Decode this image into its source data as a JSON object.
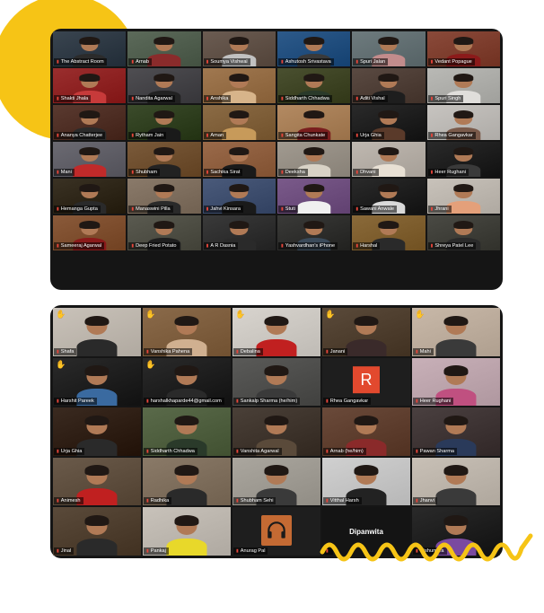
{
  "panel1": {
    "tiles": [
      {
        "name": "The Abstract Room",
        "bg": "#3a4550",
        "shirt": "#2b2b2b"
      },
      {
        "name": "Arnab",
        "bg": "#5c6a5a",
        "shirt": "#8a2b2b",
        "hl": true
      },
      {
        "name": "Soumya Vishwal",
        "bg": "#6b5c52",
        "shirt": "#c1c1c1"
      },
      {
        "name": "Ashutosh Srivastava",
        "bg": "#2d5a8a",
        "shirt": "#3a3a3a"
      },
      {
        "name": "Spuri Jalan",
        "bg": "#6e7b7e",
        "shirt": "#c28c8c"
      },
      {
        "name": "Vedant Popague",
        "bg": "#8a4a3a",
        "shirt": "#8b1a1a"
      },
      {
        "name": "Shakti Jhala",
        "bg": "#9a2e2e",
        "shirt": "#c73a3a"
      },
      {
        "name": "Nandita Agarwal",
        "bg": "#4f4e52",
        "shirt": "#222"
      },
      {
        "name": "Anshika",
        "bg": "#a07850",
        "shirt": "#d7b48a"
      },
      {
        "name": "Siddharth Chhadwa",
        "bg": "#4a5030",
        "shirt": "#2a3a2a"
      },
      {
        "name": "Aditi Vishal",
        "bg": "#5a4a42",
        "shirt": "#1e1e1e"
      },
      {
        "name": "Spuri Singh",
        "bg": "#b9b9b5",
        "shirt": "#e0dedb"
      },
      {
        "name": "Ananya Chatterjee",
        "bg": "#5a3a30",
        "shirt": "#2b2b2b"
      },
      {
        "name": "Rytham Jain",
        "bg": "#3b4b2b",
        "shirt": "#1a1a1a"
      },
      {
        "name": "Aman",
        "bg": "#8b6b45",
        "shirt": "#c79a5a"
      },
      {
        "name": "Sangita Chunkate",
        "bg": "#b38a62",
        "shirt": "#7a1e1e"
      },
      {
        "name": "Urja Ghia",
        "bg": "#2a2a2a",
        "shirt": "#5a3a2a"
      },
      {
        "name": "Rhea Gangavkar",
        "bg": "#c7c4c0",
        "shirt": "#7a5a4a"
      },
      {
        "name": "Mani",
        "bg": "#6b6a72",
        "shirt": "#c02a2a"
      },
      {
        "name": "Shubham",
        "bg": "#7a5a3a",
        "shirt": "#222"
      },
      {
        "name": "Sachika Sirat",
        "bg": "#9a6a4a",
        "shirt": "#1a1a1a"
      },
      {
        "name": "Deeksha",
        "bg": "#a19a90",
        "shirt": "#d8d2c6"
      },
      {
        "name": "Dhvani",
        "bg": "#bfb8b0",
        "shirt": "#e8e0d4"
      },
      {
        "name": "Heer Rughani",
        "bg": "#2a2a2a",
        "shirt": "#3a3a3a"
      },
      {
        "name": "Hemanga Gupta",
        "bg": "#3a3224",
        "shirt": "#2a2a2a"
      },
      {
        "name": "Manaswini Pilla",
        "bg": "#8a7a6a",
        "shirt": "#2a2a2a"
      },
      {
        "name": "Jahvi Kinsara",
        "bg": "#4a5a7a",
        "shirt": "#1a1a1a"
      },
      {
        "name": "Stuti",
        "bg": "#7a5a8a",
        "shirt": "#f0f0f0"
      },
      {
        "name": "Sawani Anwale",
        "bg": "#2a2a2a",
        "shirt": "#d9d9d9"
      },
      {
        "name": "Jhrani",
        "bg": "#c8c2ba",
        "shirt": "#e4a07a"
      },
      {
        "name": "Sameeraj Agarwal",
        "bg": "#8a5a3a",
        "shirt": "#8a1a1a"
      },
      {
        "name": "Deep Fried Potato",
        "bg": "#5a5a50",
        "shirt": "#1e1e1e"
      },
      {
        "name": "A R Dasnia",
        "bg": "#3a3a3a",
        "shirt": "#2a2a2a"
      },
      {
        "name": "Yashvardhan's iPhone",
        "bg": "#3a3a38",
        "shirt": "#3a4a5a"
      },
      {
        "name": "Harshal",
        "bg": "#8a6a3a",
        "shirt": "#2a2a2a"
      },
      {
        "name": "Shreya Patel Lee",
        "bg": "#4a4a44",
        "shirt": "#2a2a2a"
      }
    ]
  },
  "panel2": {
    "tiles": [
      {
        "name": "Shafa",
        "bg": "#c9c2b9",
        "shirt": "#2a2a2a",
        "hand": true
      },
      {
        "name": "Vanshika Pahena",
        "bg": "#8a6a4a",
        "shirt": "#d0b090",
        "hand": true
      },
      {
        "name": "Debalina",
        "bg": "#d8d4ce",
        "shirt": "#c12020",
        "hand": true
      },
      {
        "name": "Janani",
        "bg": "#5a4a3a",
        "shirt": "#3a2a2a",
        "hand": true
      },
      {
        "name": "Mahi",
        "bg": "#c8b8a8",
        "shirt": "#3a3a3a",
        "hand": true
      },
      {
        "name": "Harshit Pareek",
        "bg": "#2a2a2a",
        "shirt": "#3a6aa0",
        "hand": true
      },
      {
        "name": "harshalkhaparde44@gmail.com",
        "bg": "#2a2a2a",
        "shirt": "#2a2a2a",
        "hand": true
      },
      {
        "name": "Sankalp Sharma (he/him)",
        "bg": "#5a5a58",
        "shirt": "#3a3a3a",
        "hl": true
      },
      {
        "name": "Rhea Gangavkar",
        "avatar": "R"
      },
      {
        "name": "Heer Rughani",
        "bg": "#c8b0b8",
        "shirt": "#c05080"
      },
      {
        "name": "Urja Ghia",
        "bg": "#3a2a20",
        "shirt": "#2a2a2a"
      },
      {
        "name": "Siddharth Chhadwa",
        "bg": "#5a6a4a",
        "shirt": "#2a3a2a"
      },
      {
        "name": "Vanshita Agarwal",
        "bg": "#4a4038",
        "shirt": "#5a4a3a"
      },
      {
        "name": "Arnab (he/him)",
        "bg": "#6a4a3a",
        "shirt": "#8a2a2a"
      },
      {
        "name": "Pawan Sharma",
        "bg": "#4a4040",
        "shirt": "#2a3a5a"
      },
      {
        "name": "Animesh",
        "bg": "#6a5a4a",
        "shirt": "#c02020"
      },
      {
        "name": "Radhika",
        "bg": "#8a7a68",
        "shirt": "#2a2a2a"
      },
      {
        "name": "Shubham Sehi",
        "bg": "#aaa69e",
        "shirt": "#3a3a3a"
      },
      {
        "name": "Vitthal Harsh",
        "bg": "#d0d0d0",
        "shirt": "#222"
      },
      {
        "name": "Jhanvi",
        "bg": "#c8c0b6",
        "shirt": "#3a3a3a"
      },
      {
        "name": "Jinal",
        "bg": "#5a4a3a",
        "shirt": "#2a2a2a"
      },
      {
        "name": "Pankaj",
        "bg": "#c8c2ba",
        "shirt": "#e8d82a"
      },
      {
        "name": "Anurag Pal",
        "headphones": true
      },
      {
        "name": "Dipanwita",
        "dark": true
      },
      {
        "name": "Rishumitra",
        "bg": "#2a2a2a",
        "shirt": "#7a4aa0"
      }
    ]
  },
  "icons": {
    "mic": "mic-muted-icon",
    "hand": "raised-hand-icon",
    "headphones": "headphones-icon"
  },
  "colors": {
    "accent_yellow": "#f6c416",
    "highlight": "#a8d94a",
    "mic_muted": "#e8463b",
    "avatar_bg": "#e2492e"
  }
}
